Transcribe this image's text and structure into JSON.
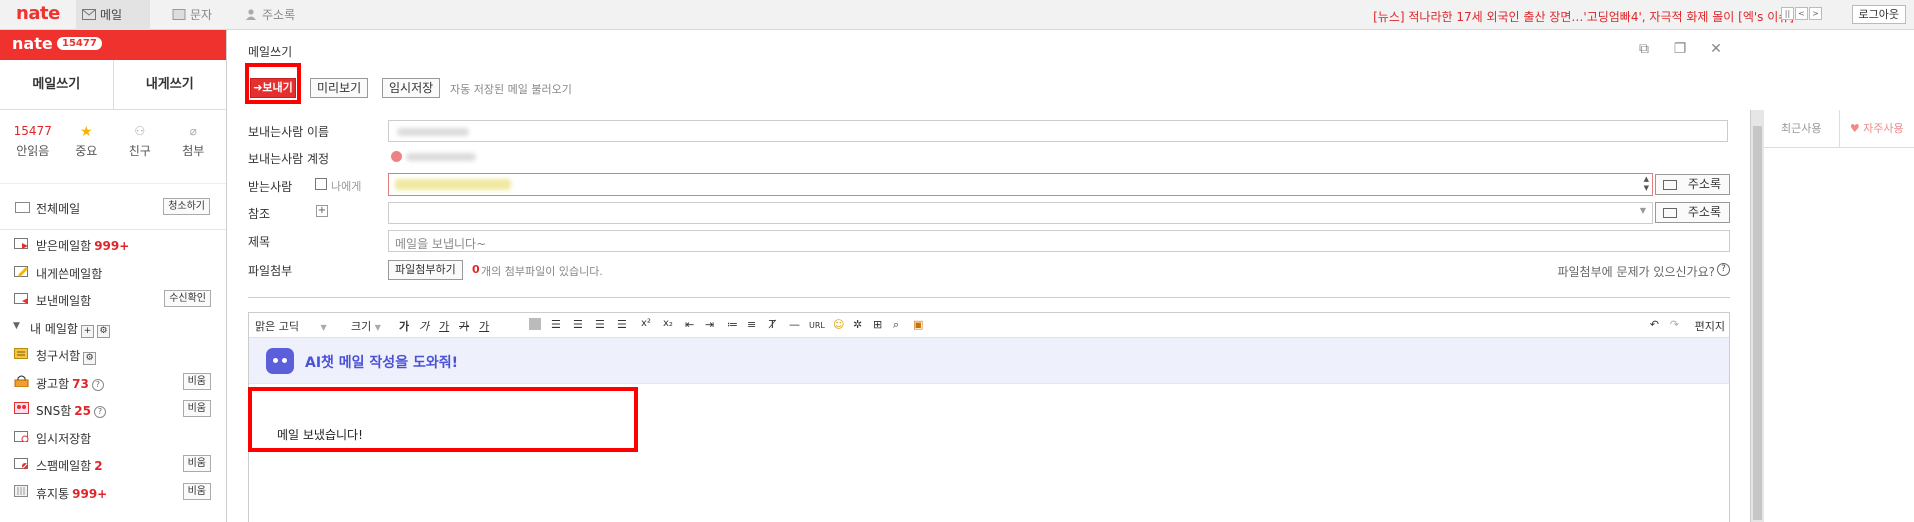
{
  "topbar": {
    "logo": "nate",
    "tabs": [
      {
        "label": "메일",
        "active": true
      },
      {
        "label": "문자",
        "active": false
      },
      {
        "label": "주소록",
        "active": false
      }
    ],
    "news": "[뉴스] 적나라한 17세 외국인 출산 장면…'고딩엄빠4', 자극적 화제 몰이 [엑's 이슈]",
    "news_nav": [
      "||",
      "<",
      ">"
    ],
    "logout": "로그아웃"
  },
  "sidebar": {
    "logo": "nate",
    "badge": "15477",
    "write_mail": "메일쓰기",
    "write_self": "내게쓰기",
    "stats": [
      {
        "top": "15477",
        "label": "안읽음"
      },
      {
        "top": "★",
        "label": "중요"
      },
      {
        "top": "⚇",
        "label": "친구"
      },
      {
        "top": "⌀",
        "label": "첨부"
      }
    ],
    "all_mail": "전체메일",
    "all_mail_btn": "청소하기",
    "folders": [
      {
        "label": "받은메일함",
        "count": "999+",
        "btn": ""
      },
      {
        "label": "내게쓴메일함",
        "count": "",
        "btn": ""
      },
      {
        "label": "보낸메일함",
        "count": "",
        "btn": "수신확인"
      },
      {
        "label": "내 메일함",
        "count": "",
        "btn": ""
      },
      {
        "label": "청구서함",
        "count": "",
        "btn": ""
      },
      {
        "label": "광고함",
        "count": "73",
        "btn": "비움"
      },
      {
        "label": "SNS함",
        "count": "25",
        "btn": "비움"
      },
      {
        "label": "임시저장함",
        "count": "",
        "btn": ""
      },
      {
        "label": "스팸메일함",
        "count": "2",
        "btn": "비움"
      },
      {
        "label": "휴지통",
        "count": "999+",
        "btn": "비움"
      }
    ]
  },
  "compose": {
    "title": "메일쓰기",
    "send": "➜보내기",
    "preview": "미리보기",
    "save_draft": "임시저장",
    "autosave": "자동 저장된 메일 불러오기",
    "sender_name_label": "보내는사람 이름",
    "sender_account_label": "보내는사람 계정",
    "to_label": "받는사람",
    "to_me": "나에게",
    "cc_label": "참조",
    "subject_label": "제목",
    "subject_value": "메일을 보냅니다~",
    "attach_label": "파일첨부",
    "attach_btn": "파일첨부하기",
    "attach_count": "0",
    "attach_info": "개의 첨부파일이 있습니다.",
    "attach_help": "파일첨부에 문제가 있으신가요?",
    "address_book": "주소록"
  },
  "editor": {
    "font": "맑은 고딕",
    "size": "크기",
    "tools": [
      "가",
      "가",
      "가",
      "가",
      "가"
    ],
    "source": "편지지",
    "ai_banner": "AI챗 메일 작성을 도와줘!",
    "body": "메일 보냈습니다!"
  },
  "right_panel": {
    "recent": "최근사용",
    "frequent": "♥ 자주사용"
  },
  "colors": {
    "brand": "#f0322e",
    "highlight": "#ff0000",
    "ai": "#4a52d8"
  }
}
